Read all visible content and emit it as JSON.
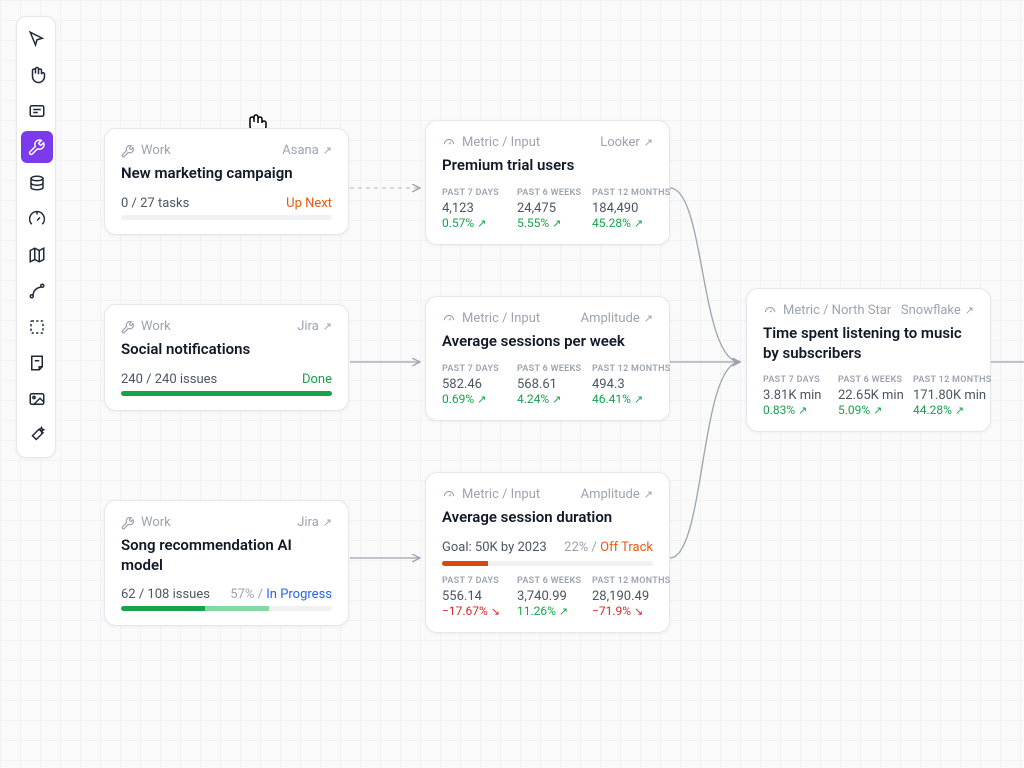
{
  "sidebar": {
    "items": [
      {
        "name": "pointer-icon"
      },
      {
        "name": "hand-icon"
      },
      {
        "name": "text-icon"
      },
      {
        "name": "wrench-icon",
        "active": true
      },
      {
        "name": "database-icon"
      },
      {
        "name": "gauge-icon"
      },
      {
        "name": "map-icon"
      },
      {
        "name": "spline-icon"
      },
      {
        "name": "select-icon"
      },
      {
        "name": "note-icon"
      },
      {
        "name": "image-icon"
      },
      {
        "name": "magic-icon"
      }
    ]
  },
  "cards": {
    "work1": {
      "type": "Work",
      "source": "Asana",
      "title": "New marketing campaign",
      "stats": "0 / 27 tasks",
      "status_label": "Up Next",
      "progress_pct": 0
    },
    "work2": {
      "type": "Work",
      "source": "Jira",
      "title": "Social notifications",
      "stats": "240 / 240 issues",
      "status_label": "Done",
      "progress_pct": 100
    },
    "work3": {
      "type": "Work",
      "source": "Jira",
      "title": "Song recommendation AI model",
      "stats": "62 / 108 issues",
      "status_pct": "57% /",
      "status_label": "In Progress",
      "progress_pct": 57
    },
    "metric1": {
      "type": "Metric / Input",
      "source": "Looker",
      "title": "Premium trial users",
      "periods": [
        {
          "label": "PAST 7 DAYS",
          "value": "4,123",
          "change": "0.57%",
          "dir": "up"
        },
        {
          "label": "PAST 6 WEEKS",
          "value": "24,475",
          "change": "5.55%",
          "dir": "up"
        },
        {
          "label": "PAST 12 MONTHS",
          "value": "184,490",
          "change": "45.28%",
          "dir": "up"
        }
      ]
    },
    "metric2": {
      "type": "Metric / Input",
      "source": "Amplitude",
      "title": "Average sessions per week",
      "periods": [
        {
          "label": "PAST 7 DAYS",
          "value": "582.46",
          "change": "0.69%",
          "dir": "up"
        },
        {
          "label": "PAST 6 WEEKS",
          "value": "568.61",
          "change": "4.24%",
          "dir": "up"
        },
        {
          "label": "PAST 12 MONTHS",
          "value": "494.3",
          "change": "46.41%",
          "dir": "up"
        }
      ]
    },
    "metric3": {
      "type": "Metric / Input",
      "source": "Amplitude",
      "title": "Average session duration",
      "goal_label": "Goal:",
      "goal_value": "50K by 2023",
      "goal_pct": "22% /",
      "goal_status": "Off Track",
      "goal_progress": 22,
      "periods": [
        {
          "label": "PAST 7 DAYS",
          "value": "556.14",
          "change": "−17.67%",
          "dir": "down"
        },
        {
          "label": "PAST 6 WEEKS",
          "value": "3,740.99",
          "change": "11.26%",
          "dir": "up"
        },
        {
          "label": "PAST 12 MONTHS",
          "value": "28,190.49",
          "change": "−71.9%",
          "dir": "down"
        }
      ]
    },
    "northstar": {
      "type": "Metric / North Star",
      "source": "Snowflake",
      "title": "Time spent listening to music by subscribers",
      "periods": [
        {
          "label": "PAST 7 DAYS",
          "value": "3.81K min",
          "change": "0.83%",
          "dir": "up"
        },
        {
          "label": "PAST 6 WEEKS",
          "value": "22.65K min",
          "change": "5.09%",
          "dir": "up"
        },
        {
          "label": "PAST 12 MONTHS",
          "value": "171.80K min",
          "change": "44.28%",
          "dir": "up"
        }
      ]
    }
  },
  "arrows": {
    "up": "↗",
    "down": "↘",
    "link": "↗"
  }
}
